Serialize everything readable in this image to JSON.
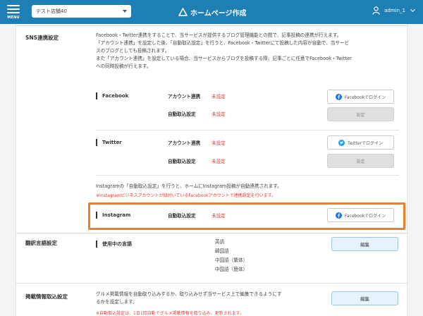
{
  "header": {
    "menu_label": "MENU",
    "store_selector_value": "テスト店舗40",
    "brand_title": "ホームページ作成",
    "username": "admin_1"
  },
  "sns": {
    "title": "SNS連携設定",
    "desc_lines": [
      "Facebook・Twitter連携をすることで、当サービスが提供するブログ管理機能との間で、記事投稿の連携が行えます。",
      "「アカウント連携」を設定した後、「自動取込設定」を行うと、Facebook・Twitterにて投稿した内容が自動で、当サービ",
      "スのブログとしても投稿されます。",
      "また「アカウント連携」を設定している場合、当サービスからブログを投稿する際、記事ごとに任意でFacebook・Twitter",
      "への同時投稿が行えます。"
    ],
    "facebook": {
      "label": "Facebook",
      "account_label": "アカウント連携",
      "account_status": "未設定",
      "login_button": "Facebookでログイン",
      "import_label": "自動取込設定",
      "import_status": "未設定",
      "settings_button": "設定"
    },
    "twitter": {
      "label": "Twitter",
      "account_label": "アカウント連携",
      "account_status": "未設定",
      "login_button": "Twitterでログイン",
      "import_label": "自動取込設定",
      "import_status": "未設定",
      "settings_button": "設定"
    },
    "instagram_note": "Instagramの「自動取込設定」を行うと、ホームにInstagram投稿が自動連携されます。",
    "instagram_warning": "※Instagramビジネスアカウントが紐付いているFacebookアカウントで連携設定を行います。",
    "instagram": {
      "label": "Instagram",
      "import_label": "自動取込設定",
      "import_status": "未設定",
      "login_button": "Facebookでログイン"
    }
  },
  "translation": {
    "title": "翻訳言語設定",
    "sub_label": "使用中の言語",
    "languages": [
      "英語",
      "韓国語",
      "中国語（繁体）",
      "中国語（簡体）"
    ],
    "edit_button": "編集"
  },
  "gourmet": {
    "title": "掲載情報取込設定",
    "desc_lines": [
      "グルメ掲載情報を自動取り込みするか、取り込みせず当サービス上で編集できるようにす",
      "るかを設定します。"
    ],
    "note": "※自動取込設定は、1日1回自動でグルメ掲載情報を取り込み、更新されます。",
    "edit_button": "編集"
  },
  "colors": {
    "header_bg": "#1e7fb5",
    "status_red": "#e0403a",
    "highlight_orange": "#f07e26",
    "facebook_blue": "#1877f2",
    "twitter_blue": "#1da1f2"
  }
}
